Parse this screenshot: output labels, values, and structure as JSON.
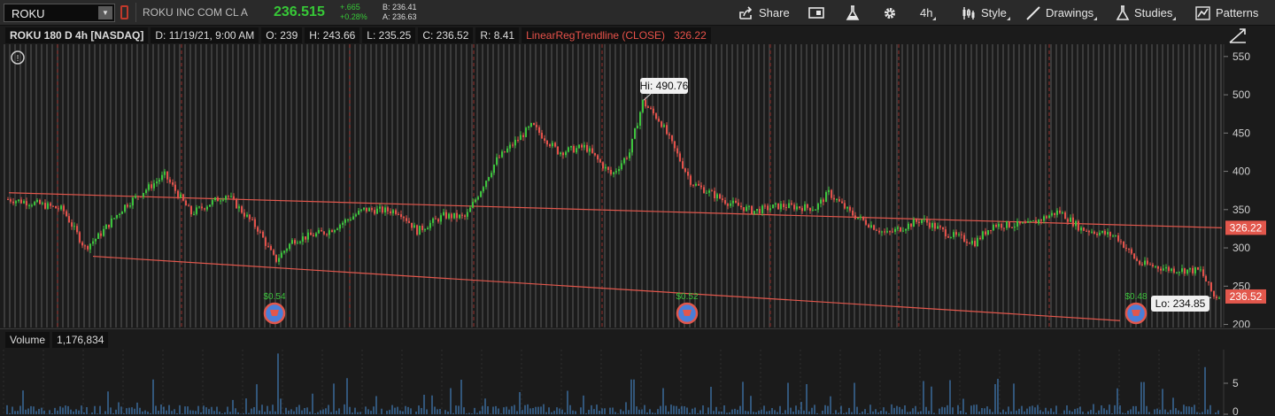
{
  "toolbar": {
    "symbol": "ROKU",
    "description": "ROKU INC COM CL A",
    "last_price": "236.515",
    "change": "+.665",
    "change_pct": "+0.28%",
    "bid": "B: 236.41",
    "ask": "A: 236.63",
    "share_label": "Share",
    "timeframe_label": "4h",
    "style_label": "Style",
    "drawings_label": "Drawings",
    "studies_label": "Studies",
    "patterns_label": "Patterns"
  },
  "chart_header": {
    "title": "ROKU 180 D 4h [NASDAQ]",
    "date": "D: 11/19/21, 9:00 AM",
    "open": "O: 239",
    "high": "H: 243.66",
    "low": "L: 235.25",
    "close": "C: 236.52",
    "range": "R: 8.41",
    "study_name": "LinearRegTrendline (CLOSE)",
    "study_value": "326.22"
  },
  "colors": {
    "up": "#3cc23c",
    "down": "#e2514a",
    "trend": "#e2574c",
    "background": "#1b1b1b",
    "volume": "#4a90d9"
  },
  "chart_data": {
    "type": "line",
    "y_axis": {
      "ticks": [
        550,
        500,
        450,
        400,
        350,
        300,
        250,
        200
      ],
      "range": [
        196,
        566
      ]
    },
    "price_path": [
      [
        0,
        365
      ],
      [
        40,
        358
      ],
      [
        70,
        350
      ],
      [
        95,
        300
      ],
      [
        110,
        315
      ],
      [
        140,
        355
      ],
      [
        185,
        395
      ],
      [
        215,
        345
      ],
      [
        255,
        370
      ],
      [
        290,
        325
      ],
      [
        310,
        283
      ],
      [
        330,
        310
      ],
      [
        370,
        322
      ],
      [
        410,
        350
      ],
      [
        450,
        348
      ],
      [
        470,
        322
      ],
      [
        500,
        342
      ],
      [
        525,
        340
      ],
      [
        560,
        415
      ],
      [
        600,
        460
      ],
      [
        630,
        425
      ],
      [
        660,
        432
      ],
      [
        690,
        395
      ],
      [
        710,
        425
      ],
      [
        725,
        490.76
      ],
      [
        745,
        465
      ],
      [
        780,
        385
      ],
      [
        820,
        360
      ],
      [
        850,
        348
      ],
      [
        880,
        355
      ],
      [
        920,
        352
      ],
      [
        935,
        372
      ],
      [
        960,
        345
      ],
      [
        1000,
        318
      ],
      [
        1040,
        337
      ],
      [
        1070,
        318
      ],
      [
        1100,
        307
      ],
      [
        1120,
        330
      ],
      [
        1160,
        330
      ],
      [
        1195,
        348
      ],
      [
        1220,
        325
      ],
      [
        1260,
        315
      ],
      [
        1285,
        280
      ],
      [
        1320,
        272
      ],
      [
        1355,
        270
      ],
      [
        1370,
        236.52
      ],
      [
        1380,
        236.52
      ]
    ],
    "trendline": {
      "start": [
        10,
        372
      ],
      "end": [
        1380,
        326.22
      ]
    },
    "support_line": {
      "start": [
        105,
        289
      ],
      "end": [
        1265,
        205
      ]
    },
    "hi_marker": {
      "label": "Hi: 490.76",
      "value": 490.76
    },
    "lo_marker": {
      "label": "Lo: 234.85",
      "value": 234.85
    },
    "price_tags": [
      {
        "label": "326.22",
        "value": 326.22
      },
      {
        "label": "236.52",
        "value": 236.52
      }
    ],
    "dividends": [
      {
        "label": "$0.54",
        "x": 310
      },
      {
        "label": "$0.52",
        "x": 776
      },
      {
        "label": "$0.48",
        "x": 1283
      }
    ],
    "volume": {
      "label": "Volume",
      "value": "1,176,834",
      "y_ticks": [
        5,
        0
      ],
      "y_range": [
        0,
        10
      ]
    }
  }
}
